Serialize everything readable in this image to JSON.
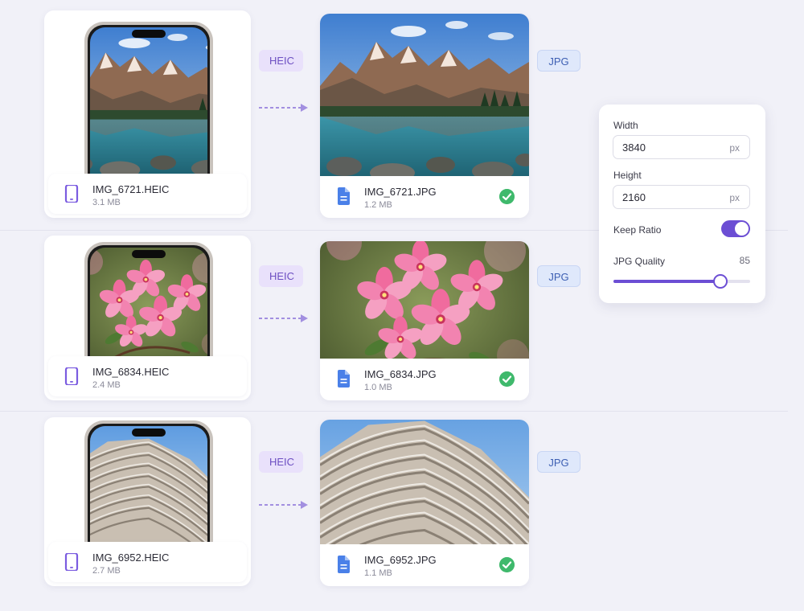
{
  "rows": [
    {
      "src_name": "IMG_6721.HEIC",
      "src_size": "3.1 MB",
      "src_format": "HEIC",
      "dst_format": "JPG",
      "dst_name": "IMG_6721.JPG",
      "dst_size": "1.2 MB",
      "image": "mountain-lake"
    },
    {
      "src_name": "IMG_6834.HEIC",
      "src_size": "2.4 MB",
      "src_format": "HEIC",
      "dst_format": "JPG",
      "dst_name": "IMG_6834.JPG",
      "dst_size": "1.0 MB",
      "image": "pink-blossoms"
    },
    {
      "src_name": "IMG_6952.HEIC",
      "src_size": "2.7 MB",
      "src_format": "HEIC",
      "dst_format": "JPG",
      "dst_name": "IMG_6952.JPG",
      "dst_size": "1.1 MB",
      "image": "curved-building"
    }
  ],
  "settings": {
    "width_label": "Width",
    "width_value": "3840",
    "width_unit": "px",
    "height_label": "Height",
    "height_value": "2160",
    "height_unit": "px",
    "keep_ratio_label": "Keep Ratio",
    "keep_ratio_on": true,
    "quality_label": "JPG Quality",
    "quality_value": "85",
    "quality_fraction": 0.78
  },
  "colors": {
    "accent": "#6c4ed4",
    "heic_badge_bg": "#e9e1fb",
    "heic_badge_text": "#6d4fc2",
    "jpg_badge_bg": "#dfe8fb",
    "jpg_badge_text": "#3d5fb3",
    "success": "#3fb96c",
    "phone_icon": "#7b5ce0",
    "doc_icon": "#4a80e8"
  }
}
